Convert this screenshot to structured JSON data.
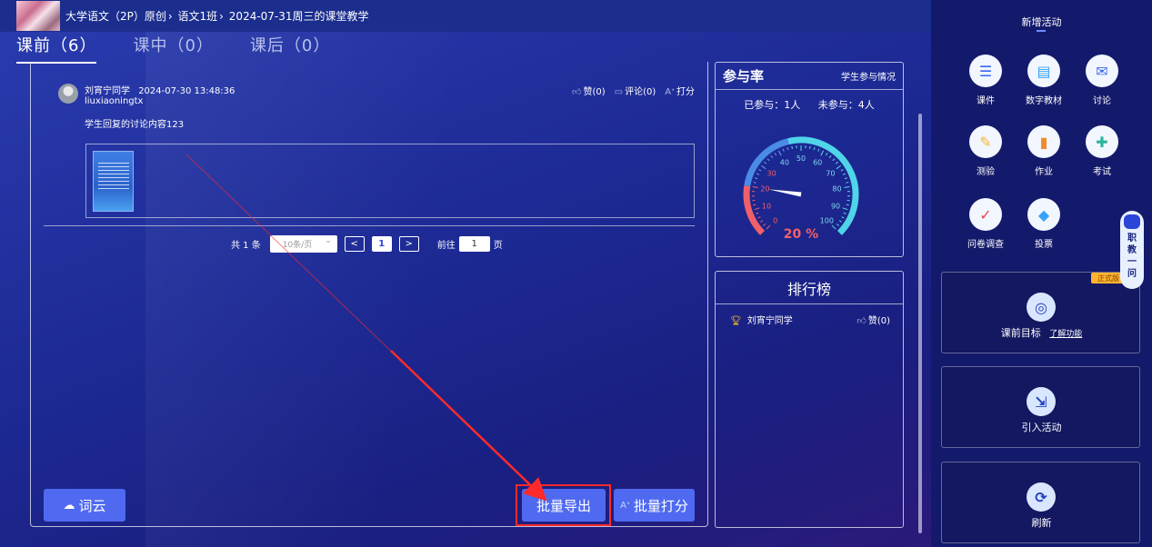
{
  "breadcrumb": [
    "大学语文（2P）原创",
    "语文1班",
    "2024-07-31周三的课堂教学"
  ],
  "tabs": [
    {
      "label": "课前（6）",
      "active": true
    },
    {
      "label": "课中（0）",
      "active": false
    },
    {
      "label": "课后（0）",
      "active": false
    }
  ],
  "comment": {
    "name": "刘宵宁同学",
    "time": "2024-07-30 13:48:36",
    "username": "liuxiaoningtx",
    "like": "赞(0)",
    "comment_count": "评论(0)",
    "score": "打分",
    "text": "学生回复的讨论内容123"
  },
  "pager": {
    "total": "共 1 条",
    "page_size": "10条/页",
    "prev": "<",
    "current": "1",
    "next": ">",
    "goto_label": "前往",
    "goto_value": "1",
    "page_unit": "页"
  },
  "buttons": {
    "word_cloud": "词云",
    "batch_export": "批量导出",
    "batch_score": "批量打分"
  },
  "participation": {
    "title": "参与率",
    "link": "学生参与情况",
    "joined": "已参与：1人",
    "not_joined": "未参与：4人",
    "percent": "20 %",
    "value": 20,
    "ticks": [
      "0",
      "10",
      "20",
      "30",
      "40",
      "50",
      "60",
      "70",
      "80",
      "90",
      "100"
    ]
  },
  "ranking": {
    "title": "排行榜",
    "rows": [
      {
        "name": "刘宵宁同学",
        "likes": "赞(0)"
      }
    ]
  },
  "sidebar": {
    "title": "新增活动",
    "activities": [
      {
        "label": "课件",
        "icon": "courseware-icon",
        "color": "#3a67f0",
        "glyph": "☰"
      },
      {
        "label": "数字教材",
        "icon": "digital-textbook-icon",
        "color": "#38a3f5",
        "glyph": "▤"
      },
      {
        "label": "讨论",
        "icon": "discussion-icon",
        "color": "#3a67f0",
        "glyph": "✉"
      },
      {
        "label": "测验",
        "icon": "quiz-icon",
        "color": "#f5b731",
        "glyph": "✎"
      },
      {
        "label": "作业",
        "icon": "homework-icon",
        "color": "#f08a2a",
        "glyph": "▮"
      },
      {
        "label": "考试",
        "icon": "exam-icon",
        "color": "#2bb59b",
        "glyph": "✚"
      },
      {
        "label": "问卷调查",
        "icon": "survey-icon",
        "color": "#e84a4a",
        "glyph": "✓"
      },
      {
        "label": "投票",
        "icon": "vote-icon",
        "color": "#38a3f5",
        "glyph": "◆"
      }
    ],
    "goal": "课前目标",
    "goal_link": "了解功能",
    "import": "引入活动",
    "refresh": "刷新",
    "badge": "正式版",
    "assistant": [
      "职",
      "教",
      "一",
      "问"
    ]
  }
}
